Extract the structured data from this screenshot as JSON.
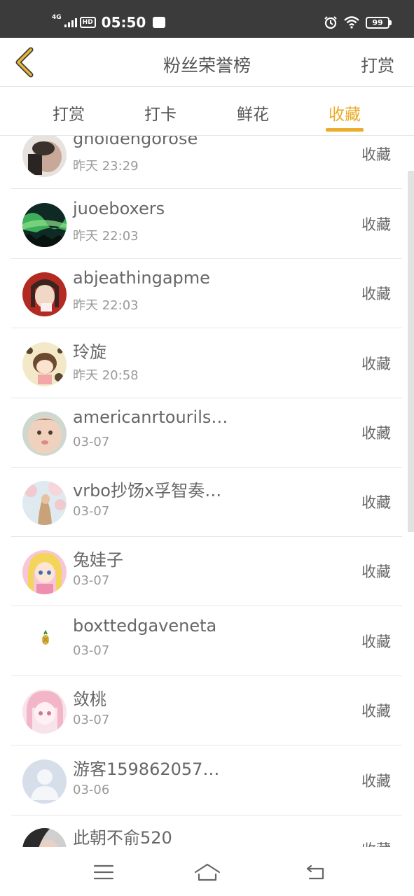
{
  "status_bar": {
    "network": "4G",
    "hd_label": "HD",
    "time": "05:50",
    "battery": "99"
  },
  "header": {
    "title": "粉丝荣誉榜",
    "action_label": "打赏"
  },
  "tabs": [
    {
      "label": "打赏",
      "active": false
    },
    {
      "label": "打卡",
      "active": false
    },
    {
      "label": "鲜花",
      "active": false
    },
    {
      "label": "收藏",
      "active": true
    }
  ],
  "accent_color": "#ecab2b",
  "rows": [
    {
      "name": "gnoldengorose",
      "time": "昨天 23:29",
      "action": "收藏",
      "avatar": "photo-avatar"
    },
    {
      "name": "juoeboxers",
      "time": "昨天 22:03",
      "action": "收藏",
      "avatar": "aurora-avatar"
    },
    {
      "name": "abjeathingapme",
      "time": "昨天 22:03",
      "action": "收藏",
      "avatar": "photo-avatar"
    },
    {
      "name": "玲旋",
      "time": "昨天 20:58",
      "action": "收藏",
      "avatar": "cartoon-avatar"
    },
    {
      "name": "americanrtourils…",
      "time": "03-07",
      "action": "收藏",
      "avatar": "baby-avatar"
    },
    {
      "name": "vrbo抄饧x孚智奏…",
      "time": "03-07",
      "action": "收藏",
      "avatar": "blossom-avatar"
    },
    {
      "name": "兔娃子",
      "time": "03-07",
      "action": "收藏",
      "avatar": "anime-avatar"
    },
    {
      "name": "boxttedgaveneta",
      "time": "03-07",
      "action": "收藏",
      "avatar": "pineapple-avatar"
    },
    {
      "name": "敛桃",
      "time": "03-07",
      "action": "收藏",
      "avatar": "anime-pink-avatar"
    },
    {
      "name": "游客159862057…",
      "time": "03-06",
      "action": "收藏",
      "avatar": "default-avatar"
    },
    {
      "name": "此朝不俞520",
      "time": "",
      "action": "收藏",
      "avatar": "photo-avatar"
    }
  ]
}
